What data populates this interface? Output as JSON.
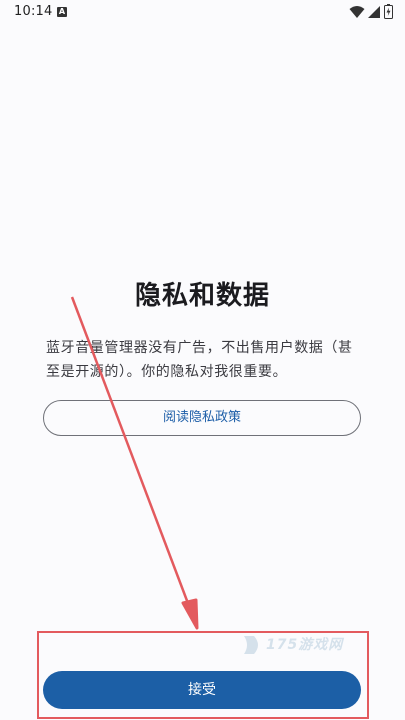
{
  "status_bar": {
    "time": "10:14",
    "notification_icon": "A",
    "icons": [
      "wifi-icon",
      "signal-icon",
      "battery-icon"
    ]
  },
  "privacy": {
    "title": "隐私和数据",
    "description": "蓝牙音量管理器没有广告，不出售用户数据（甚至是开源的）。你的隐私对我很重要。",
    "policy_button_label": "阅读隐私政策",
    "accept_button_label": "接受"
  },
  "watermark": {
    "text": "175游戏网"
  },
  "colors": {
    "background": "#fbfbfd",
    "accent": "#1c5fa6",
    "annotation": "#e35a5e"
  }
}
